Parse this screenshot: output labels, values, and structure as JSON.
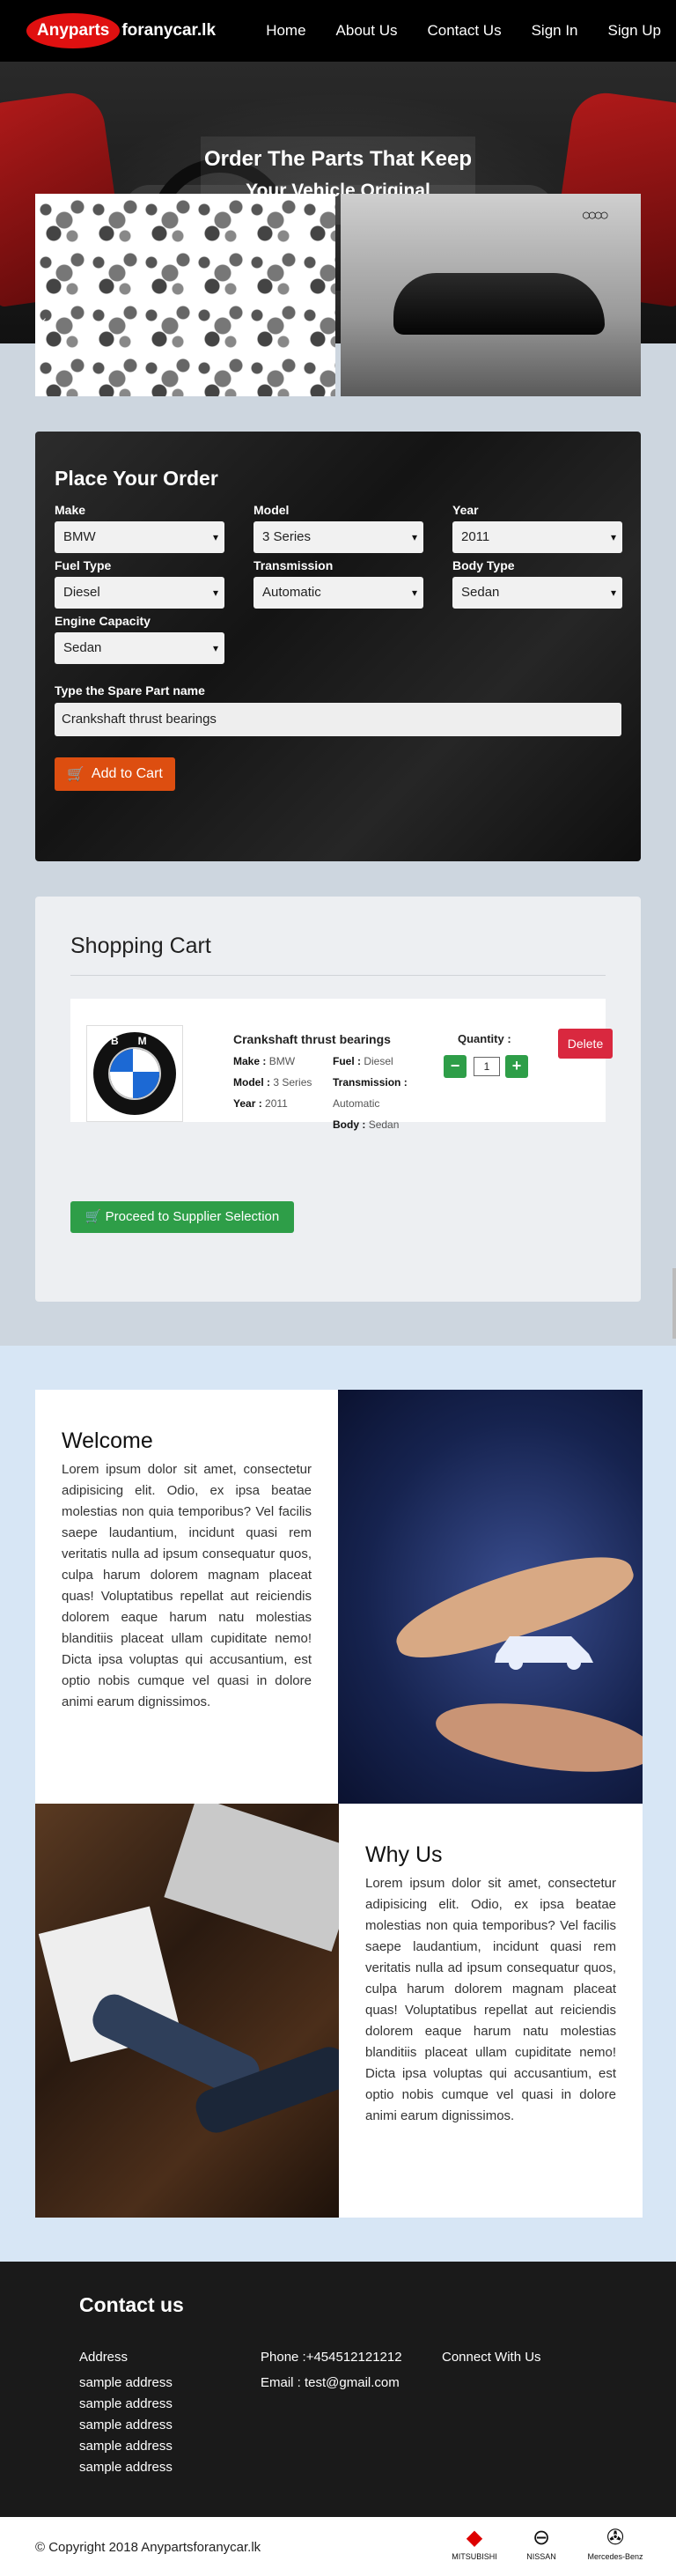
{
  "nav": {
    "logo_highlight": "Anyparts",
    "logo_rest": "foranycar.lk",
    "links": [
      "Home",
      "About Us",
      "Contact Us",
      "Sign In",
      "Sign Up"
    ]
  },
  "hero": {
    "title": "Order The Parts That Keep",
    "subtitle": "Your Vehicle Original"
  },
  "order_form": {
    "title": "Place Your Order",
    "fields": [
      {
        "label": "Make",
        "value": "BMW"
      },
      {
        "label": "Model",
        "value": "3 Series"
      },
      {
        "label": "Year",
        "value": "2011"
      },
      {
        "label": "Fuel Type",
        "value": "Diesel"
      },
      {
        "label": "Transmission",
        "value": "Automatic"
      },
      {
        "label": "Body Type",
        "value": "Sedan"
      },
      {
        "label": "Engine Capacity",
        "value": "Sedan"
      }
    ],
    "spare_label": "Type the Spare Part name",
    "spare_value": "Crankshaft thrust bearings",
    "add_button": "Add to Cart"
  },
  "cart": {
    "title": "Shopping Cart",
    "item": {
      "name": "Crankshaft thrust bearings",
      "make_label": "Make :",
      "make": "BMW",
      "model_label": "Model :",
      "model": "3 Series",
      "year_label": "Year :",
      "year": "2011",
      "fuel_label": "Fuel :",
      "fuel": "Diesel",
      "transmission_label": "Transmission :",
      "transmission": "Automatic",
      "body_label": "Body :",
      "body": "Sedan",
      "quantity_label": "Quantity :",
      "quantity": "1",
      "brand_text": "BMW"
    },
    "delete_button": "Delete",
    "proceed_button": "Proceed to Supplier Selection"
  },
  "about": {
    "welcome_title": "Welcome",
    "welcome_text": "Lorem ipsum dolor sit amet, consectetur adipisicing elit. Odio, ex ipsa beatae molestias non quia temporibus? Vel facilis saepe laudantium, incidunt quasi rem veritatis nulla ad ipsum consequatur quos, culpa harum dolorem magnam placeat quas! Voluptatibus repellat aut reiciendis dolorem eaque harum natu molestias blanditiis placeat ullam cupiditate nemo! Dicta ipsa voluptas qui accusantium, est optio nobis cumque vel quasi in dolore animi earum dignissimos.",
    "why_title": "Why Us",
    "why_text": "Lorem ipsum dolor sit amet, consectetur adipisicing elit. Odio, ex ipsa beatae molestias non quia temporibus? Vel facilis saepe laudantium, incidunt quasi rem veritatis nulla ad ipsum consequatur quos, culpa harum dolorem magnam placeat quas! Voluptatibus repellat aut reiciendis dolorem eaque harum natu molestias blanditiis placeat ullam cupiditate nemo! Dicta ipsa voluptas qui accusantium, est optio nobis cumque vel quasi in dolore animi earum dignissimos."
  },
  "footer": {
    "title": "Contact us",
    "address_heading": "Address",
    "address_lines": [
      "sample address",
      "sample address",
      "sample address",
      "sample address",
      "sample address"
    ],
    "phone": "Phone :+454512121212",
    "email": "Email : test@gmail.com",
    "connect": "Connect With Us",
    "copyright": "© Copyright 2018 Anypartsforanycar.lk",
    "brands": [
      "MITSUBISHI",
      "NISSAN",
      "Mercedes-Benz"
    ]
  },
  "colors": {
    "accent_orange": "#dd4e10",
    "success_green": "#2e9e48",
    "danger_red": "#d9283f",
    "logo_red": "#e01010"
  }
}
